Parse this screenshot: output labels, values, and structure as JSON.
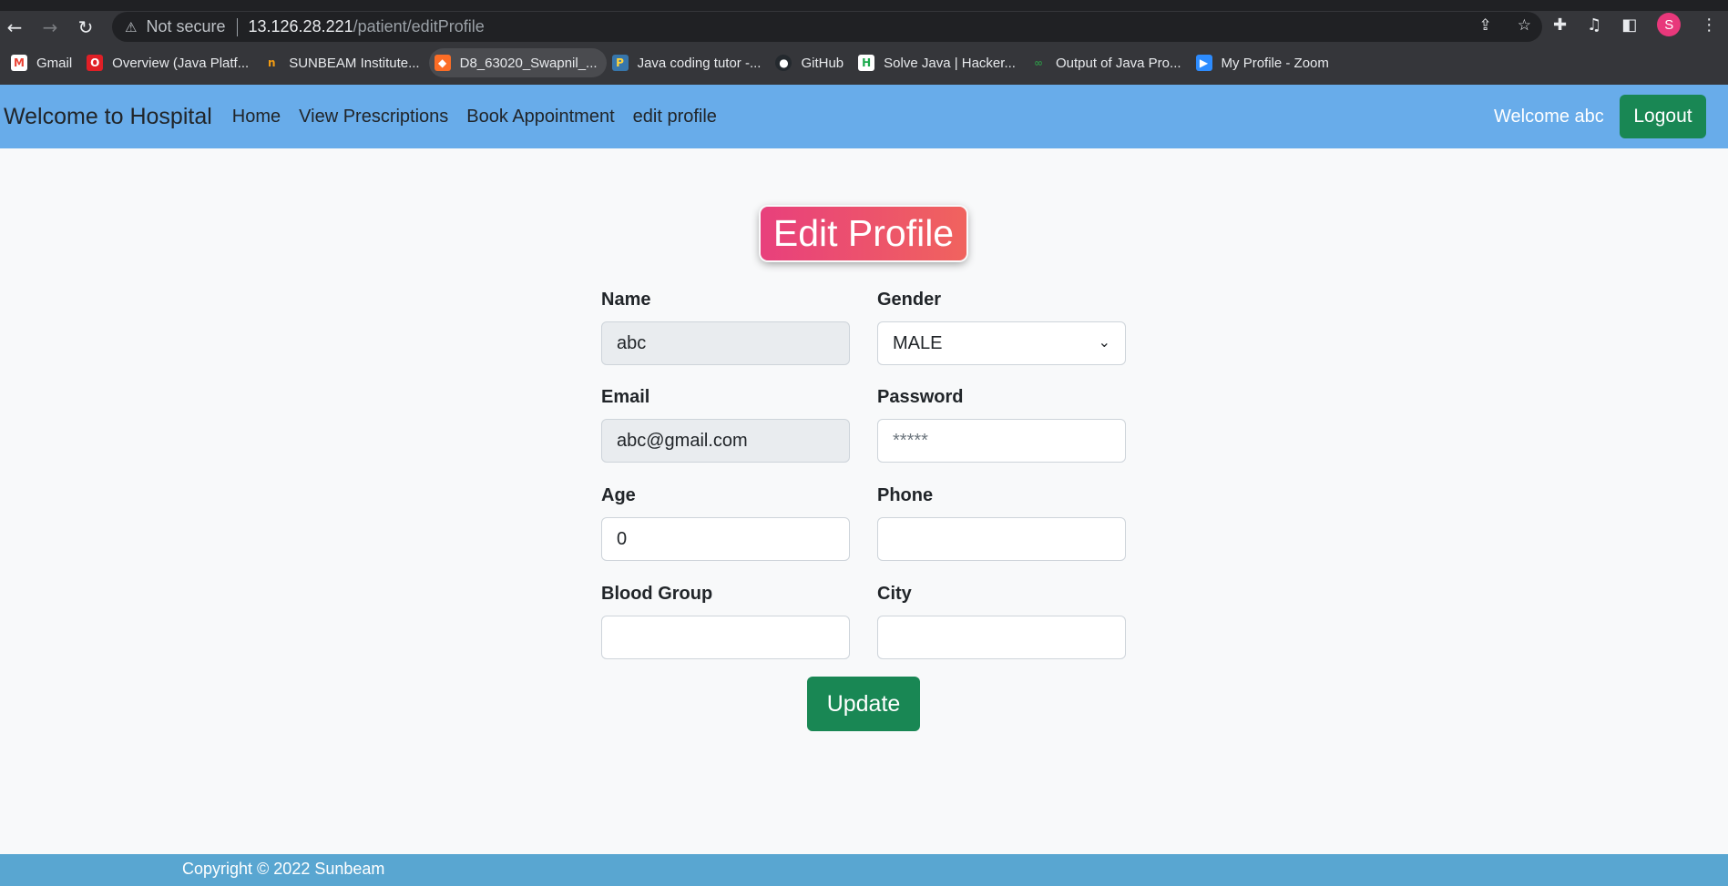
{
  "browser": {
    "not_secure": "Not secure",
    "url_host": "13.126.28.221",
    "url_path": "/patient/editProfile",
    "avatar_letter": "S",
    "bookmarks": [
      {
        "label": "Gmail",
        "icon": "gmail-icon",
        "color": "#ea4335"
      },
      {
        "label": "Overview (Java Platf...",
        "icon": "oracle-icon",
        "color": "#e01f26"
      },
      {
        "label": "SUNBEAM Institute...",
        "icon": "sunbeam-icon",
        "color": "#f39c12"
      },
      {
        "label": "D8_63020_Swapnil_...",
        "icon": "gitlab-icon",
        "color": "#fc6d26"
      },
      {
        "label": "Java coding tutor -...",
        "icon": "python-icon",
        "color": "#3776ab"
      },
      {
        "label": "GitHub",
        "icon": "github-icon",
        "color": "#24292e"
      },
      {
        "label": "Solve Java | Hacker...",
        "icon": "hackerrank-icon",
        "color": "#1ba94c"
      },
      {
        "label": "Output of Java Pro...",
        "icon": "geeksforgeeks-icon",
        "color": "#2f8d46"
      },
      {
        "label": "My Profile - Zoom",
        "icon": "zoom-icon",
        "color": "#2d8cff"
      }
    ]
  },
  "navbar": {
    "brand": "Welcome to Hospital",
    "links": [
      "Home",
      "View Prescriptions",
      "Book Appointment",
      "edit profile"
    ],
    "welcome": "Welcome abc",
    "logout": "Logout"
  },
  "form": {
    "title": "Edit Profile",
    "name_label": "Name",
    "name_value": "abc",
    "gender_label": "Gender",
    "gender_value": "MALE",
    "email_label": "Email",
    "email_value": "abc@gmail.com",
    "password_label": "Password",
    "password_placeholder": "*****",
    "age_label": "Age",
    "age_value": "0",
    "phone_label": "Phone",
    "phone_value": "",
    "blood_group_label": "Blood Group",
    "blood_group_value": "",
    "city_label": "City",
    "city_value": "",
    "submit": "Update"
  },
  "footer": {
    "text": "Copyright © 2022 Sunbeam"
  }
}
